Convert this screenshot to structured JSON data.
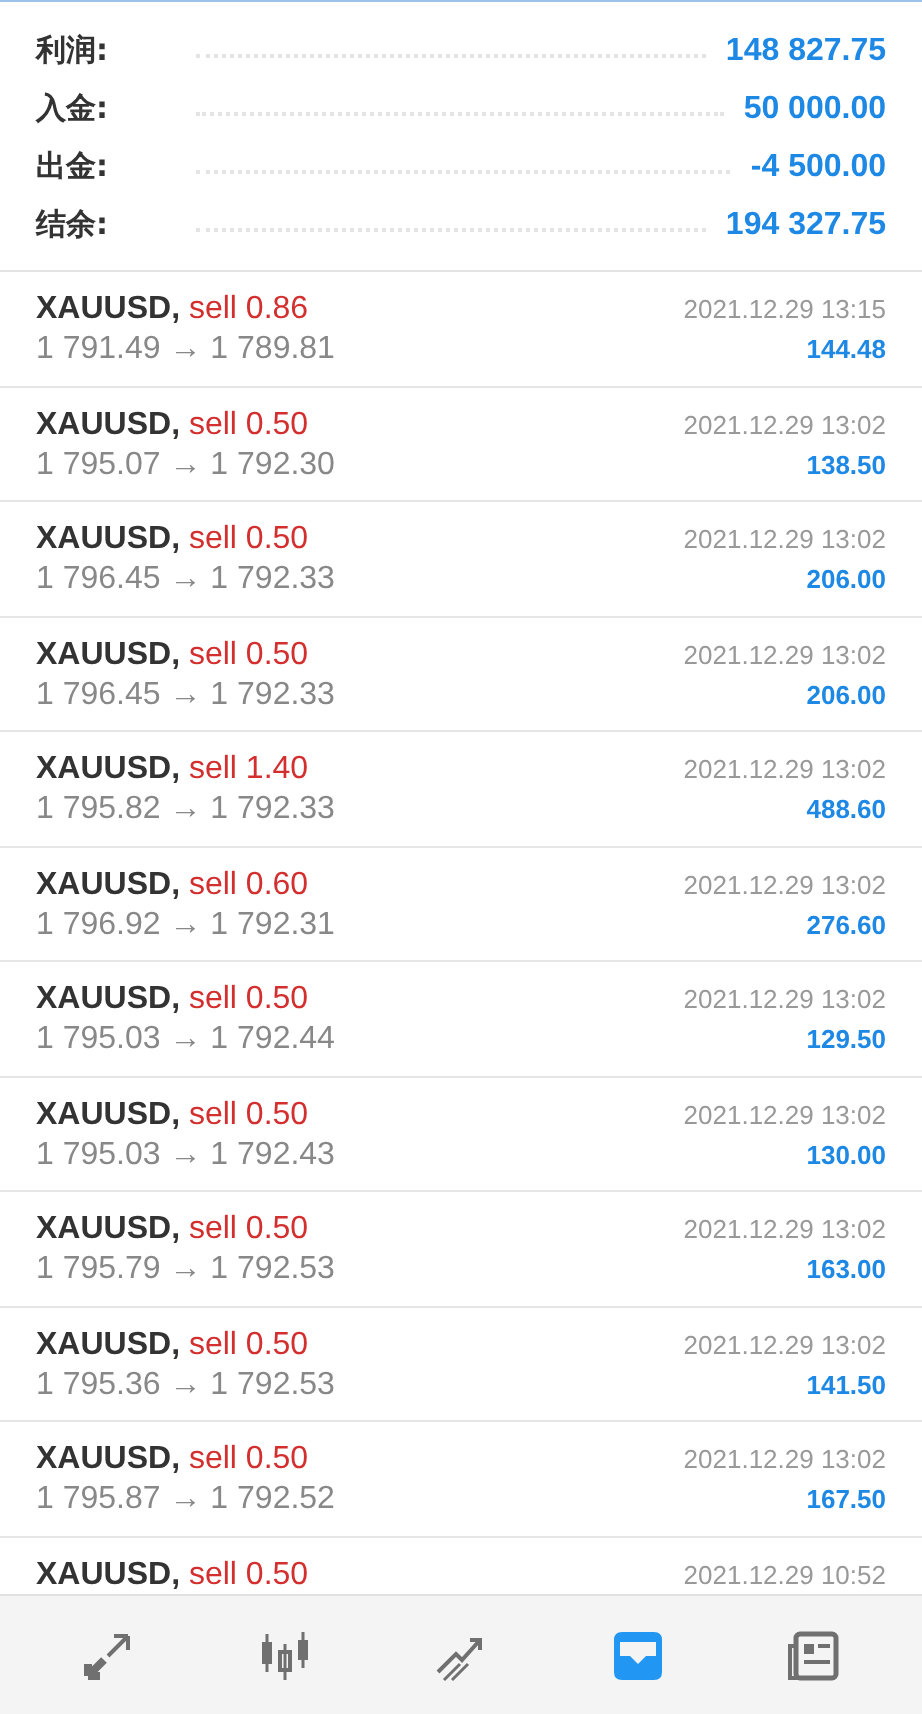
{
  "summary": [
    {
      "label": "利润:",
      "value": "148 827.75"
    },
    {
      "label": "入金:",
      "value": "50 000.00"
    },
    {
      "label": "出金:",
      "value": "-4 500.00"
    },
    {
      "label": "结余:",
      "value": "194 327.75"
    }
  ],
  "trades": [
    {
      "symbol": "XAUUSD,",
      "order": "sell 0.86",
      "prices": "1 791.49 → 1 789.81",
      "time": "2021.12.29 13:15",
      "profit": "144.48"
    },
    {
      "symbol": "XAUUSD,",
      "order": "sell 0.50",
      "prices": "1 795.07 → 1 792.30",
      "time": "2021.12.29 13:02",
      "profit": "138.50"
    },
    {
      "symbol": "XAUUSD,",
      "order": "sell 0.50",
      "prices": "1 796.45 → 1 792.33",
      "time": "2021.12.29 13:02",
      "profit": "206.00"
    },
    {
      "symbol": "XAUUSD,",
      "order": "sell 0.50",
      "prices": "1 796.45 → 1 792.33",
      "time": "2021.12.29 13:02",
      "profit": "206.00"
    },
    {
      "symbol": "XAUUSD,",
      "order": "sell 1.40",
      "prices": "1 795.82 → 1 792.33",
      "time": "2021.12.29 13:02",
      "profit": "488.60"
    },
    {
      "symbol": "XAUUSD,",
      "order": "sell 0.60",
      "prices": "1 796.92 → 1 792.31",
      "time": "2021.12.29 13:02",
      "profit": "276.60"
    },
    {
      "symbol": "XAUUSD,",
      "order": "sell 0.50",
      "prices": "1 795.03 → 1 792.44",
      "time": "2021.12.29 13:02",
      "profit": "129.50"
    },
    {
      "symbol": "XAUUSD,",
      "order": "sell 0.50",
      "prices": "1 795.03 → 1 792.43",
      "time": "2021.12.29 13:02",
      "profit": "130.00"
    },
    {
      "symbol": "XAUUSD,",
      "order": "sell 0.50",
      "prices": "1 795.79 → 1 792.53",
      "time": "2021.12.29 13:02",
      "profit": "163.00"
    },
    {
      "symbol": "XAUUSD,",
      "order": "sell 0.50",
      "prices": "1 795.36 → 1 792.53",
      "time": "2021.12.29 13:02",
      "profit": "141.50"
    },
    {
      "symbol": "XAUUSD,",
      "order": "sell 0.50",
      "prices": "1 795.87 → 1 792.52",
      "time": "2021.12.29 13:02",
      "profit": "167.50"
    },
    {
      "symbol": "XAUUSD,",
      "order": "sell 0.50",
      "time": "2021.12.29 10:52"
    }
  ],
  "tabs": [
    {
      "selected": false
    },
    {
      "selected": false
    },
    {
      "selected": false
    },
    {
      "selected": true
    },
    {
      "selected": false
    }
  ]
}
